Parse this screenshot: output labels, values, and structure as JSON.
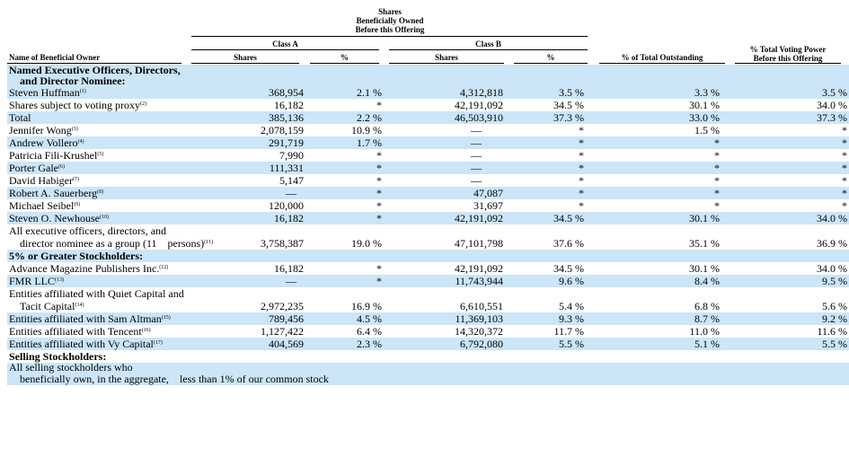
{
  "header": {
    "group_title_line1": "Shares",
    "group_title_line2": "Beneficially Owned",
    "group_title_line3": "Before this Offering",
    "class_a": "Class A",
    "class_b": "Class B",
    "col_name": "Name of Beneficial Owner",
    "col_a_shares": "Shares",
    "col_a_pct": "%",
    "col_b_shares": "Shares",
    "col_b_pct": "%",
    "col_total_outstanding": "% of Total Outstanding",
    "col_voting_line1": "% Total Voting Power",
    "col_voting_line2": "Before this Offering"
  },
  "sections": {
    "named_line1": "Named Executive Officers, Directors,",
    "named_line2": "and Director Nominee:",
    "five_pct": "5% or Greater Stockholders:",
    "selling": "Selling Stockholders:"
  },
  "rows": [
    {
      "name": "Steven Huffman",
      "fn": "(1)",
      "a": "368,954",
      "ap": "2.1 %",
      "b": "4,312,818",
      "bp": "3.5 %",
      "t": "3.3 %",
      "v": "3.5 %"
    },
    {
      "name": "Shares subject to voting proxy",
      "fn": "(2)",
      "a": "16,182",
      "ap": "*",
      "b": "42,191,092",
      "bp": "34.5 %",
      "t": "30.1 %",
      "v": "34.0 %"
    },
    {
      "name": "Total",
      "fn": "",
      "a": "385,136",
      "ap": "2.2 %",
      "b": "46,503,910",
      "bp": "37.3 %",
      "t": "33.0 %",
      "v": "37.3 %"
    },
    {
      "name": "Jennifer Wong",
      "fn": "(3)",
      "a": "2,078,159",
      "ap": "10.9 %",
      "b": "—",
      "bp": "*",
      "t": "1.5 %",
      "v": "*"
    },
    {
      "name": "Andrew Vollero",
      "fn": "(4)",
      "a": "291,719",
      "ap": "1.7 %",
      "b": "—",
      "bp": "*",
      "t": "*",
      "v": "*"
    },
    {
      "name": "Patricia Fili-Krushel",
      "fn": "(5)",
      "a": "7,990",
      "ap": "*",
      "b": "—",
      "bp": "*",
      "t": "*",
      "v": "*"
    },
    {
      "name": "Porter Gale",
      "fn": "(6)",
      "a": "111,331",
      "ap": "*",
      "b": "—",
      "bp": "*",
      "t": "*",
      "v": "*"
    },
    {
      "name": "David Habiger",
      "fn": "(7)",
      "a": "5,147",
      "ap": "*",
      "b": "—",
      "bp": "*",
      "t": "*",
      "v": "*"
    },
    {
      "name": "Robert A. Sauerberg",
      "fn": "(8)",
      "a": "—",
      "ap": "*",
      "b": "47,087",
      "bp": "*",
      "t": "*",
      "v": "*"
    },
    {
      "name": "Michael Seibel",
      "fn": "(9)",
      "a": "120,000",
      "ap": "*",
      "b": "31,697",
      "bp": "*",
      "t": "*",
      "v": "*"
    },
    {
      "name": "Steven O. Newhouse",
      "fn": "(10)",
      "a": "16,182",
      "ap": "*",
      "b": "42,191,092",
      "bp": "34.5 %",
      "t": "30.1 %",
      "v": "34.0 %"
    }
  ],
  "group_row": {
    "line1": "All executive officers, directors, and",
    "line2": "director nominee as a group (11",
    "line3": "persons)",
    "fn": "(11)",
    "a": "3,758,387",
    "ap": "19.0 %",
    "b": "47,101,798",
    "bp": "37.6 %",
    "t": "35.1 %",
    "v": "36.9 %"
  },
  "five_pct_rows": [
    {
      "name": "Advance Magazine Publishers Inc.",
      "fn": "(12)",
      "a": "16,182",
      "ap": "*",
      "b": "42,191,092",
      "bp": "34.5 %",
      "t": "30.1 %",
      "v": "34.0 %"
    },
    {
      "name": "FMR LLC",
      "fn": "(13)",
      "a": "—",
      "ap": "*",
      "b": "11,743,944",
      "bp": "9.6 %",
      "t": "8.4 %",
      "v": "9.5 %"
    }
  ],
  "quiet_row": {
    "line1": "Entities affiliated with Quiet Capital and",
    "line2": "Tacit Capital",
    "fn": "(14)",
    "a": "2,972,235",
    "ap": "16.9 %",
    "b": "6,610,551",
    "bp": "5.4 %",
    "t": "6.8 %",
    "v": "5.6 %"
  },
  "five_pct_rows_2": [
    {
      "name": "Entities affiliated with Sam Altman",
      "fn": "(15)",
      "a": "789,456",
      "ap": "4.5 %",
      "b": "11,369,103",
      "bp": "9.3 %",
      "t": "8.7 %",
      "v": "9.2 %"
    },
    {
      "name": "Entities affiliated with Tencent",
      "fn": "(16)",
      "a": "1,127,422",
      "ap": "6.4 %",
      "b": "14,320,372",
      "bp": "11.7 %",
      "t": "11.0 %",
      "v": "11.6 %"
    },
    {
      "name": "Entities affiliated with Vy Capital",
      "fn": "(17)",
      "a": "404,569",
      "ap": "2.3 %",
      "b": "6,792,080",
      "bp": "5.5 %",
      "t": "5.1 %",
      "v": "5.5 %"
    }
  ],
  "selling_row": {
    "line1": "All selling stockholders who",
    "line2": "beneficially own, in the aggregate,",
    "line3": "less than 1% of our common stock"
  },
  "colors": {
    "row_shade": "#cce5f7"
  }
}
